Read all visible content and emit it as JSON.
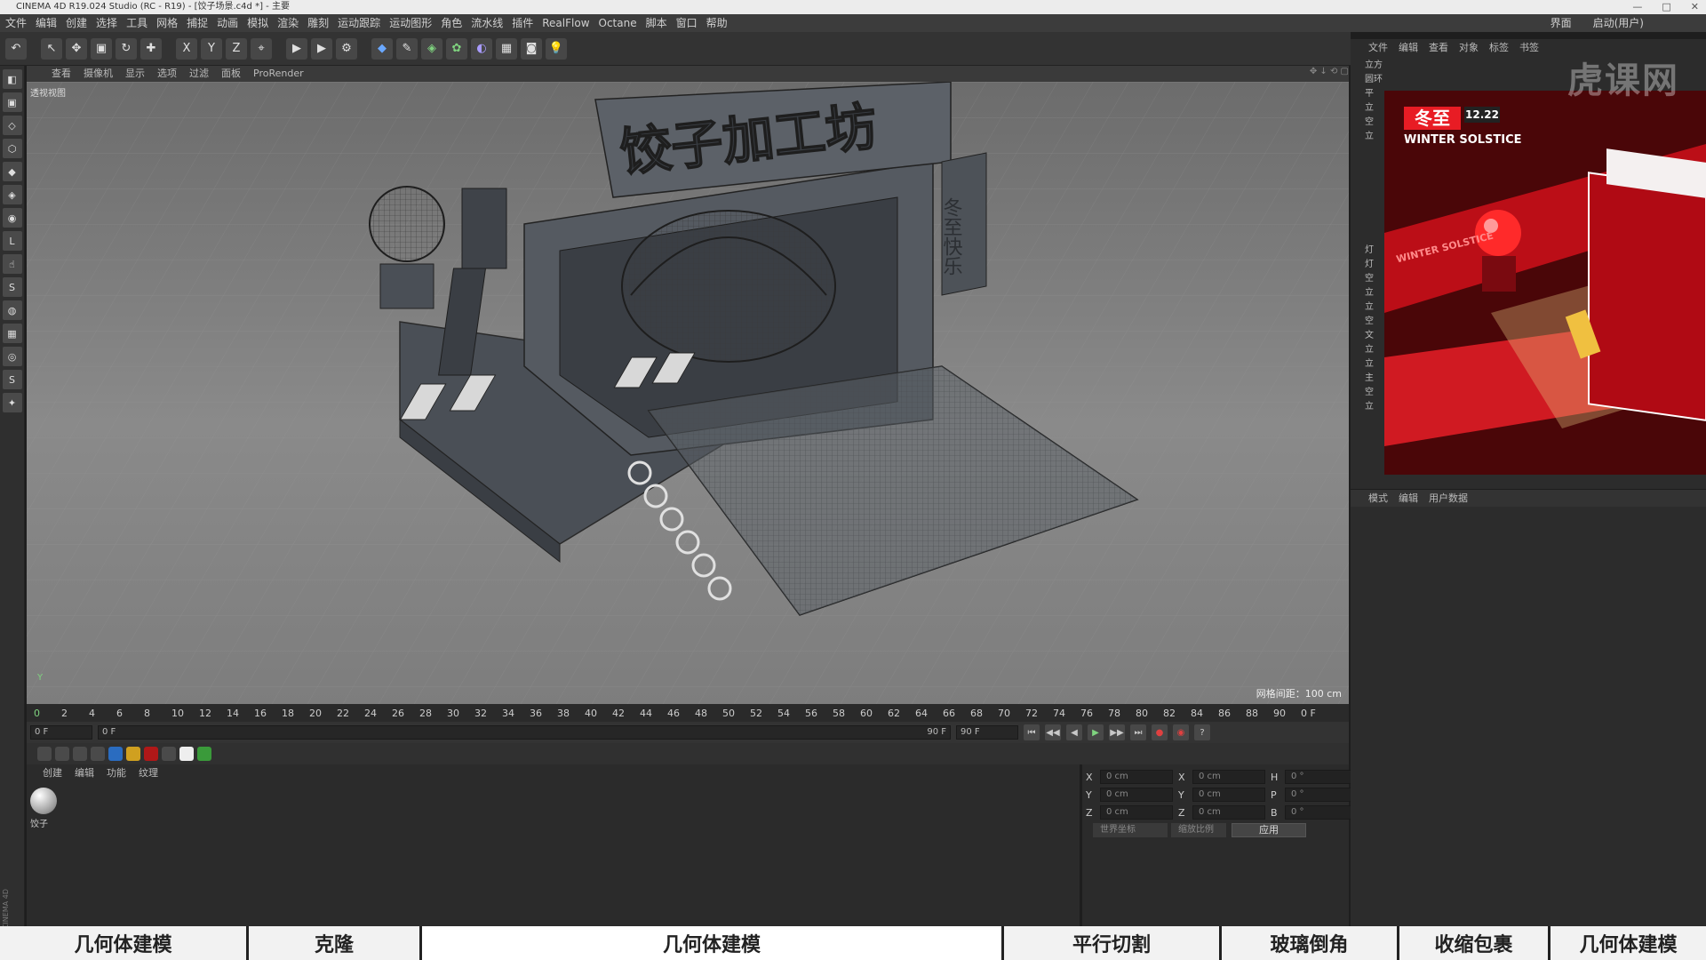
{
  "window": {
    "title": "CINEMA 4D R19.024 Studio (RC - R19) - [饺子场景.c4d *] - 主要",
    "controls": [
      "—",
      "□",
      "✕"
    ]
  },
  "menubar": {
    "items": [
      "文件",
      "编辑",
      "创建",
      "选择",
      "工具",
      "网格",
      "捕捉",
      "动画",
      "模拟",
      "渲染",
      "雕刻",
      "运动跟踪",
      "运动图形",
      "角色",
      "流水线",
      "插件",
      "RealFlow",
      "Octane",
      "脚本",
      "窗口",
      "帮助"
    ],
    "layout_label": "界面",
    "layout_value": "启动(用户)"
  },
  "toolbar": {
    "icons": [
      "undo-icon",
      "select-icon",
      "move-icon",
      "scale-icon",
      "rotate-icon",
      "add-icon",
      "x-axis-icon",
      "y-axis-icon",
      "z-axis-icon",
      "coord-icon",
      "render-view-icon",
      "render-icon",
      "render-settings-icon",
      "cube-icon",
      "pen-icon",
      "subdivision-icon",
      "cloner-icon",
      "deformer-icon",
      "floor-icon",
      "camera-icon",
      "light-icon"
    ],
    "glyphs": [
      "↶",
      "↖",
      "✥",
      "▣",
      "↻",
      "✚",
      "X",
      "Y",
      "Z",
      "⌖",
      "▶",
      "▶",
      "⚙",
      "◆",
      "✎",
      "◈",
      "✿",
      "◐",
      "▦",
      "◙",
      "💡"
    ]
  },
  "lefttools": {
    "glyphs": [
      "◧",
      "▣",
      "◇",
      "⬡",
      "◆",
      "◈",
      "◉",
      "L",
      "☝",
      "S",
      "◍",
      "▦",
      "◎",
      "S",
      "✦"
    ]
  },
  "left_brand": "MAXON CINEMA 4D",
  "viewport": {
    "menu": [
      "查看",
      "摄像机",
      "显示",
      "选项",
      "过滤",
      "面板",
      "ProRender"
    ],
    "label": "透视视图",
    "grid_spacing": "网格间距：100 cm",
    "axis": "Y",
    "sign_text": "饺子加工坊",
    "side_sign_text": "冬至快乐"
  },
  "timeline": {
    "ticks": [
      "0",
      "2",
      "4",
      "6",
      "8",
      "10",
      "12",
      "14",
      "16",
      "18",
      "20",
      "22",
      "24",
      "26",
      "28",
      "30",
      "32",
      "34",
      "36",
      "38",
      "40",
      "42",
      "44",
      "46",
      "48",
      "50",
      "52",
      "54",
      "56",
      "58",
      "60",
      "62",
      "64",
      "66",
      "68",
      "70",
      "72",
      "74",
      "76",
      "78",
      "80",
      "82",
      "84",
      "86",
      "88",
      "90"
    ],
    "current_frame": "0 F"
  },
  "transport": {
    "start": "0 F",
    "range_start": "0 F",
    "range_end": "90 F",
    "end": "90 F",
    "buttons": [
      "⏮",
      "◀◀",
      "◀",
      "▶",
      "▶▶",
      "⏭"
    ]
  },
  "materials": {
    "menu": [
      "创建",
      "编辑",
      "功能",
      "纹理"
    ],
    "items": [
      {
        "name": "饺子"
      }
    ]
  },
  "coordinates": {
    "rows": [
      {
        "a": "X",
        "a_val": "0 cm",
        "b": "X",
        "b_val": "0 cm",
        "c": "H",
        "c_val": "0 °"
      },
      {
        "a": "Y",
        "a_val": "0 cm",
        "b": "Y",
        "b_val": "0 cm",
        "c": "P",
        "c_val": "0 °"
      },
      {
        "a": "Z",
        "a_val": "0 cm",
        "b": "Z",
        "b_val": "0 cm",
        "c": "B",
        "c_val": "0 °"
      }
    ],
    "mode1": "世界坐标",
    "mode2": "缩放比例",
    "apply": "应用"
  },
  "object_manager": {
    "menu": [
      "文件",
      "编辑",
      "查看",
      "对象",
      "标签",
      "书签"
    ],
    "rows": [
      "立方",
      "圆环",
      "平",
      "立",
      "空",
      "立",
      "",
      "",
      "",
      "",
      "",
      "",
      "",
      "灯",
      "灯",
      "空",
      "立",
      "立",
      "空",
      "文",
      "立",
      "立",
      "主",
      "空",
      "立"
    ]
  },
  "reference": {
    "title_cn": "冬至",
    "date": "12.22",
    "title_en": "WINTER SOLSTICE",
    "banner": "WINTER SOLSTICE"
  },
  "attributes": {
    "menu": [
      "模式",
      "编辑",
      "用户数据"
    ]
  },
  "watermark": "虎课网",
  "bottom_tabs": [
    {
      "label": "几何体建模",
      "active": false
    },
    {
      "label": "克隆",
      "active": false
    },
    {
      "label": "几何体建模",
      "active": true
    },
    {
      "label": "平行切割",
      "active": false
    },
    {
      "label": "玻璃倒角",
      "active": false
    },
    {
      "label": "收缩包裹",
      "active": false
    },
    {
      "label": "几何体建模",
      "active": false
    }
  ],
  "colors": {
    "accent_red": "#d0101a",
    "viewport_bg": "#7a7a7a"
  }
}
